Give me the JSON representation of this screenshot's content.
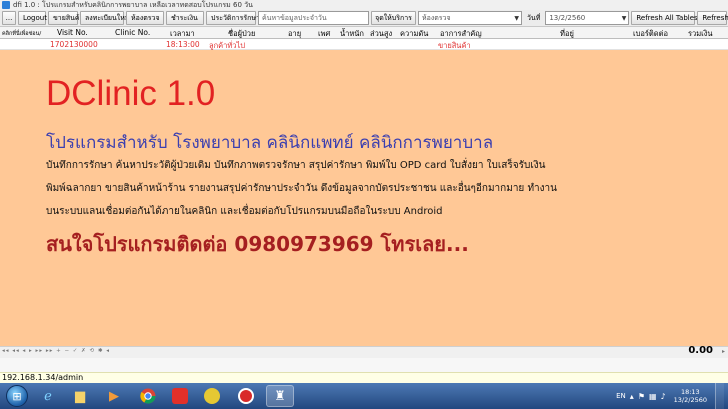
{
  "window": {
    "title": "dfi 1.0 : โปรแกรมสำหรับคลินิกการพยาบาล เหลือเวลาทดสอบโปรแกรม 60 วัน"
  },
  "toolbar": {
    "small_btn_label": "...",
    "logout": "Logout",
    "sell": "ขายสินค้า",
    "register": "ลงทะเบียนใหม่",
    "exam_room": "ห้องตรวจ",
    "payment": "ชำระเงิน",
    "treatment_history": "ประวัติการรักษา",
    "search_placeholder": "ค้นหาข้อมูลประจำวัน",
    "service_point_label": "จุดให้บริการ",
    "service_point_value": "ห้องตรวจ",
    "date_label": "วันที่",
    "date_value": "13/2/2560",
    "refresh_all": "Refresh All Tables",
    "refresh": "Refresh"
  },
  "grid": {
    "headers": [
      "คลิกที่นี่เพื่อซ่อน/",
      "Visit No.",
      "Clinic No.",
      "เวลามา",
      "ชื่อผู้ป่วย",
      "อายุ",
      "เพศ",
      "น้ำหนัก",
      "ส่วนสูง",
      "ความดัน",
      "อาการสำคัญ",
      "ที่อยู่",
      "เบอร์ติดต่อ",
      "รวมเงิน"
    ],
    "row": {
      "visit_no": "1702130000",
      "time": "18:13:00",
      "patient": "ลูกค้าทั่วไป",
      "symptom": "ขายสินค้า"
    }
  },
  "banner": {
    "app_name": "DClinic 1.0",
    "subtitle": "โปรแกรมสำหรับ โรงพยาบาล คลินิกแพทย์ คลินิกการพยาบาล",
    "description_lines": [
      "บันทึกการรักษา ค้นหาประวัติผู้ป่วยเดิม บันทึกภาพตรวจรักษา สรุปค่ารักษา พิมพ์ใบ OPD card ใบสั่งยา ใบเสร็จรับเงิน",
      "พิมพ์ฉลากยา ขายสินค้าหน้าร้าน รายงานสรุปค่ารักษาประจำวัน ดึงข้อมูลจากบัตรประชาชน  และอื่นๆอีกมากมาย ทำงาน",
      "บนระบบแลนเชื่อมต่อกันได้ภายในคลินิก และเชื่อมต่อกับโปรแกรมบนมือถือในระบบ Android"
    ],
    "contact": "สนใจโปรแกรมติดต่อ 0980973969 โทรเลย..."
  },
  "navbar": {
    "glyphs": "◂◂ ◂◂ ◂ ▸ ▸▸ ▸▸ + − ✓ ✗ ⟲ ✱ ◂"
  },
  "totals": {
    "total": "0.00"
  },
  "status": {
    "url": "192.168.1.34/admin"
  },
  "taskbar": {
    "icons": [
      "start-orb",
      "internet-explorer-icon",
      "file-explorer-icon",
      "media-player-icon",
      "chrome-icon",
      "app-icon",
      "line-icon",
      "app-record-icon",
      "dclinic-icon"
    ],
    "lang": "EN",
    "time": "18:13",
    "date": "13/2/2560"
  }
}
